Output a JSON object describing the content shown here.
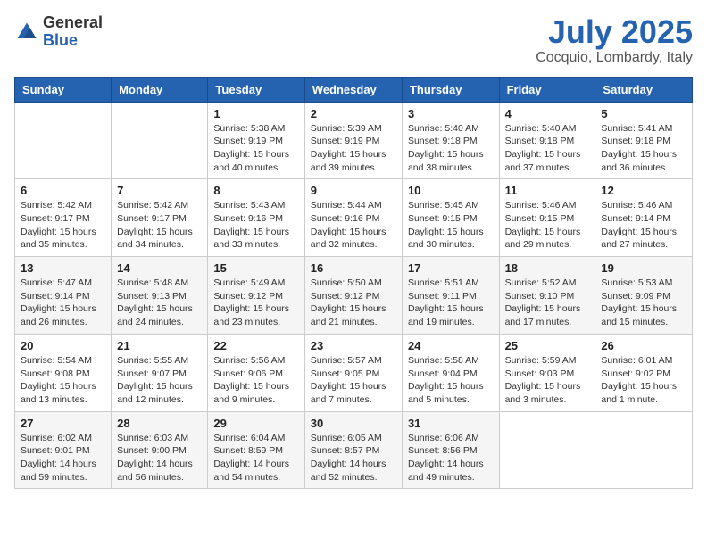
{
  "header": {
    "logo_general": "General",
    "logo_blue": "Blue",
    "title": "July 2025",
    "subtitle": "Cocquio, Lombardy, Italy"
  },
  "days_of_week": [
    "Sunday",
    "Monday",
    "Tuesday",
    "Wednesday",
    "Thursday",
    "Friday",
    "Saturday"
  ],
  "weeks": [
    [
      {
        "num": "",
        "sunrise": "",
        "sunset": "",
        "daylight": ""
      },
      {
        "num": "",
        "sunrise": "",
        "sunset": "",
        "daylight": ""
      },
      {
        "num": "1",
        "sunrise": "Sunrise: 5:38 AM",
        "sunset": "Sunset: 9:19 PM",
        "daylight": "Daylight: 15 hours and 40 minutes."
      },
      {
        "num": "2",
        "sunrise": "Sunrise: 5:39 AM",
        "sunset": "Sunset: 9:19 PM",
        "daylight": "Daylight: 15 hours and 39 minutes."
      },
      {
        "num": "3",
        "sunrise": "Sunrise: 5:40 AM",
        "sunset": "Sunset: 9:18 PM",
        "daylight": "Daylight: 15 hours and 38 minutes."
      },
      {
        "num": "4",
        "sunrise": "Sunrise: 5:40 AM",
        "sunset": "Sunset: 9:18 PM",
        "daylight": "Daylight: 15 hours and 37 minutes."
      },
      {
        "num": "5",
        "sunrise": "Sunrise: 5:41 AM",
        "sunset": "Sunset: 9:18 PM",
        "daylight": "Daylight: 15 hours and 36 minutes."
      }
    ],
    [
      {
        "num": "6",
        "sunrise": "Sunrise: 5:42 AM",
        "sunset": "Sunset: 9:17 PM",
        "daylight": "Daylight: 15 hours and 35 minutes."
      },
      {
        "num": "7",
        "sunrise": "Sunrise: 5:42 AM",
        "sunset": "Sunset: 9:17 PM",
        "daylight": "Daylight: 15 hours and 34 minutes."
      },
      {
        "num": "8",
        "sunrise": "Sunrise: 5:43 AM",
        "sunset": "Sunset: 9:16 PM",
        "daylight": "Daylight: 15 hours and 33 minutes."
      },
      {
        "num": "9",
        "sunrise": "Sunrise: 5:44 AM",
        "sunset": "Sunset: 9:16 PM",
        "daylight": "Daylight: 15 hours and 32 minutes."
      },
      {
        "num": "10",
        "sunrise": "Sunrise: 5:45 AM",
        "sunset": "Sunset: 9:15 PM",
        "daylight": "Daylight: 15 hours and 30 minutes."
      },
      {
        "num": "11",
        "sunrise": "Sunrise: 5:46 AM",
        "sunset": "Sunset: 9:15 PM",
        "daylight": "Daylight: 15 hours and 29 minutes."
      },
      {
        "num": "12",
        "sunrise": "Sunrise: 5:46 AM",
        "sunset": "Sunset: 9:14 PM",
        "daylight": "Daylight: 15 hours and 27 minutes."
      }
    ],
    [
      {
        "num": "13",
        "sunrise": "Sunrise: 5:47 AM",
        "sunset": "Sunset: 9:14 PM",
        "daylight": "Daylight: 15 hours and 26 minutes."
      },
      {
        "num": "14",
        "sunrise": "Sunrise: 5:48 AM",
        "sunset": "Sunset: 9:13 PM",
        "daylight": "Daylight: 15 hours and 24 minutes."
      },
      {
        "num": "15",
        "sunrise": "Sunrise: 5:49 AM",
        "sunset": "Sunset: 9:12 PM",
        "daylight": "Daylight: 15 hours and 23 minutes."
      },
      {
        "num": "16",
        "sunrise": "Sunrise: 5:50 AM",
        "sunset": "Sunset: 9:12 PM",
        "daylight": "Daylight: 15 hours and 21 minutes."
      },
      {
        "num": "17",
        "sunrise": "Sunrise: 5:51 AM",
        "sunset": "Sunset: 9:11 PM",
        "daylight": "Daylight: 15 hours and 19 minutes."
      },
      {
        "num": "18",
        "sunrise": "Sunrise: 5:52 AM",
        "sunset": "Sunset: 9:10 PM",
        "daylight": "Daylight: 15 hours and 17 minutes."
      },
      {
        "num": "19",
        "sunrise": "Sunrise: 5:53 AM",
        "sunset": "Sunset: 9:09 PM",
        "daylight": "Daylight: 15 hours and 15 minutes."
      }
    ],
    [
      {
        "num": "20",
        "sunrise": "Sunrise: 5:54 AM",
        "sunset": "Sunset: 9:08 PM",
        "daylight": "Daylight: 15 hours and 13 minutes."
      },
      {
        "num": "21",
        "sunrise": "Sunrise: 5:55 AM",
        "sunset": "Sunset: 9:07 PM",
        "daylight": "Daylight: 15 hours and 12 minutes."
      },
      {
        "num": "22",
        "sunrise": "Sunrise: 5:56 AM",
        "sunset": "Sunset: 9:06 PM",
        "daylight": "Daylight: 15 hours and 9 minutes."
      },
      {
        "num": "23",
        "sunrise": "Sunrise: 5:57 AM",
        "sunset": "Sunset: 9:05 PM",
        "daylight": "Daylight: 15 hours and 7 minutes."
      },
      {
        "num": "24",
        "sunrise": "Sunrise: 5:58 AM",
        "sunset": "Sunset: 9:04 PM",
        "daylight": "Daylight: 15 hours and 5 minutes."
      },
      {
        "num": "25",
        "sunrise": "Sunrise: 5:59 AM",
        "sunset": "Sunset: 9:03 PM",
        "daylight": "Daylight: 15 hours and 3 minutes."
      },
      {
        "num": "26",
        "sunrise": "Sunrise: 6:01 AM",
        "sunset": "Sunset: 9:02 PM",
        "daylight": "Daylight: 15 hours and 1 minute."
      }
    ],
    [
      {
        "num": "27",
        "sunrise": "Sunrise: 6:02 AM",
        "sunset": "Sunset: 9:01 PM",
        "daylight": "Daylight: 14 hours and 59 minutes."
      },
      {
        "num": "28",
        "sunrise": "Sunrise: 6:03 AM",
        "sunset": "Sunset: 9:00 PM",
        "daylight": "Daylight: 14 hours and 56 minutes."
      },
      {
        "num": "29",
        "sunrise": "Sunrise: 6:04 AM",
        "sunset": "Sunset: 8:59 PM",
        "daylight": "Daylight: 14 hours and 54 minutes."
      },
      {
        "num": "30",
        "sunrise": "Sunrise: 6:05 AM",
        "sunset": "Sunset: 8:57 PM",
        "daylight": "Daylight: 14 hours and 52 minutes."
      },
      {
        "num": "31",
        "sunrise": "Sunrise: 6:06 AM",
        "sunset": "Sunset: 8:56 PM",
        "daylight": "Daylight: 14 hours and 49 minutes."
      },
      {
        "num": "",
        "sunrise": "",
        "sunset": "",
        "daylight": ""
      },
      {
        "num": "",
        "sunrise": "",
        "sunset": "",
        "daylight": ""
      }
    ]
  ]
}
